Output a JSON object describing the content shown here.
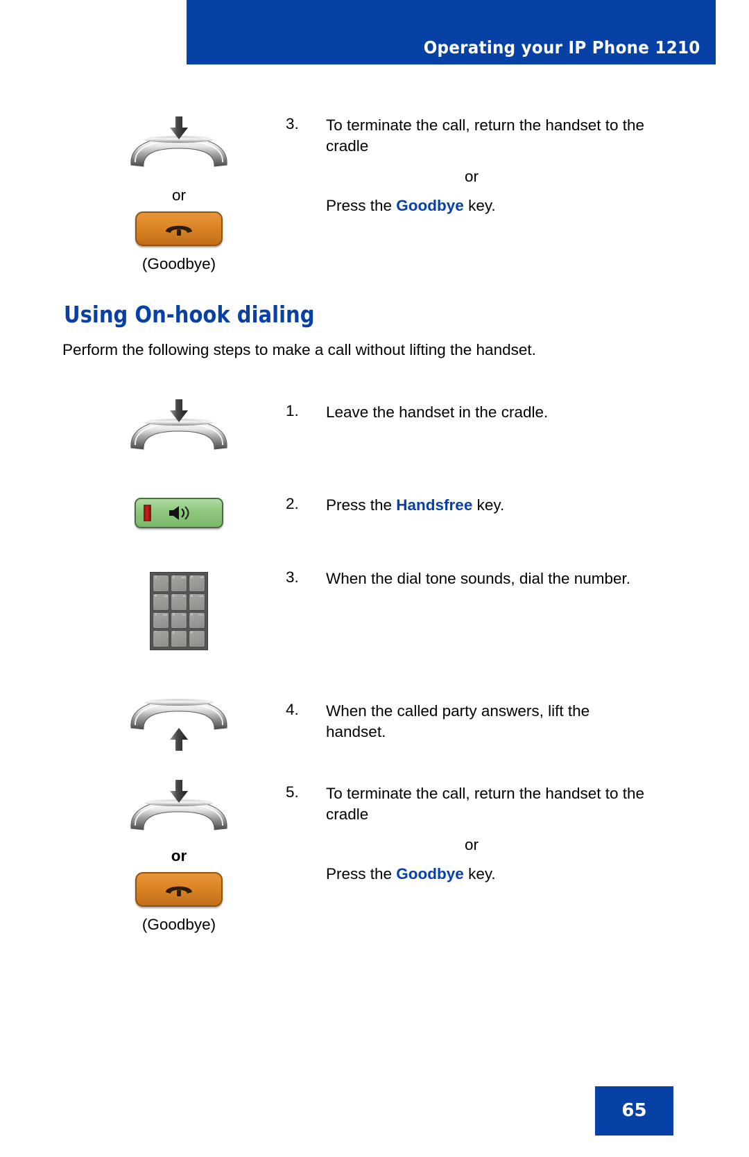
{
  "header": {
    "title": "Operating your IP Phone 1210",
    "banner_color": "#0741A6"
  },
  "top_step": {
    "number": "3.",
    "text": "To terminate the call, return the handset to the cradle",
    "or_label": "or",
    "press_prefix": "Press the ",
    "press_key": "Goodbye",
    "press_suffix": " key.",
    "icon_or_label": "or",
    "icon_caption": "(Goodbye)"
  },
  "section": {
    "heading": "Using On-hook dialing",
    "intro": "Perform the following steps to make a call without lifting the handset."
  },
  "steps": [
    {
      "number": "1.",
      "text": "Leave the handset in the cradle.",
      "icon": "handset-down-icon"
    },
    {
      "number": "2.",
      "press_prefix": "Press the ",
      "press_key": "Handsfree",
      "press_suffix": " key.",
      "icon": "handsfree-key-icon"
    },
    {
      "number": "3.",
      "text": "When the dial tone sounds, dial the number.",
      "icon": "keypad-icon"
    },
    {
      "number": "4.",
      "text": "When the called party answers, lift the handset.",
      "icon": "handset-up-icon"
    },
    {
      "number": "5.",
      "text": "To terminate the call, return the handset to the cradle",
      "or_label": "or",
      "press_prefix": "Press the ",
      "press_key": "Goodbye",
      "press_suffix": " key.",
      "icon_or_label": "or",
      "icon_caption": "(Goodbye)"
    }
  ],
  "keypad": {
    "keys": [
      {
        "digit": "1",
        "letters": ""
      },
      {
        "digit": "2",
        "letters": "abc"
      },
      {
        "digit": "3",
        "letters": "def"
      },
      {
        "digit": "4",
        "letters": "ghi"
      },
      {
        "digit": "5",
        "letters": "jkl"
      },
      {
        "digit": "6",
        "letters": "mno"
      },
      {
        "digit": "7",
        "letters": "pqrs"
      },
      {
        "digit": "8",
        "letters": "tuv"
      },
      {
        "digit": "9",
        "letters": "wxyz"
      },
      {
        "digit": "*",
        "letters": ""
      },
      {
        "digit": "0",
        "letters": ""
      },
      {
        "digit": "#",
        "letters": ""
      }
    ]
  },
  "footer": {
    "page_number": "65",
    "banner_color": "#0741A6"
  },
  "colors": {
    "brand_blue": "#0741A6",
    "goodbye_orange": "#DD8628",
    "handsfree_green": "#8CC67C",
    "led_red": "#D02020"
  }
}
